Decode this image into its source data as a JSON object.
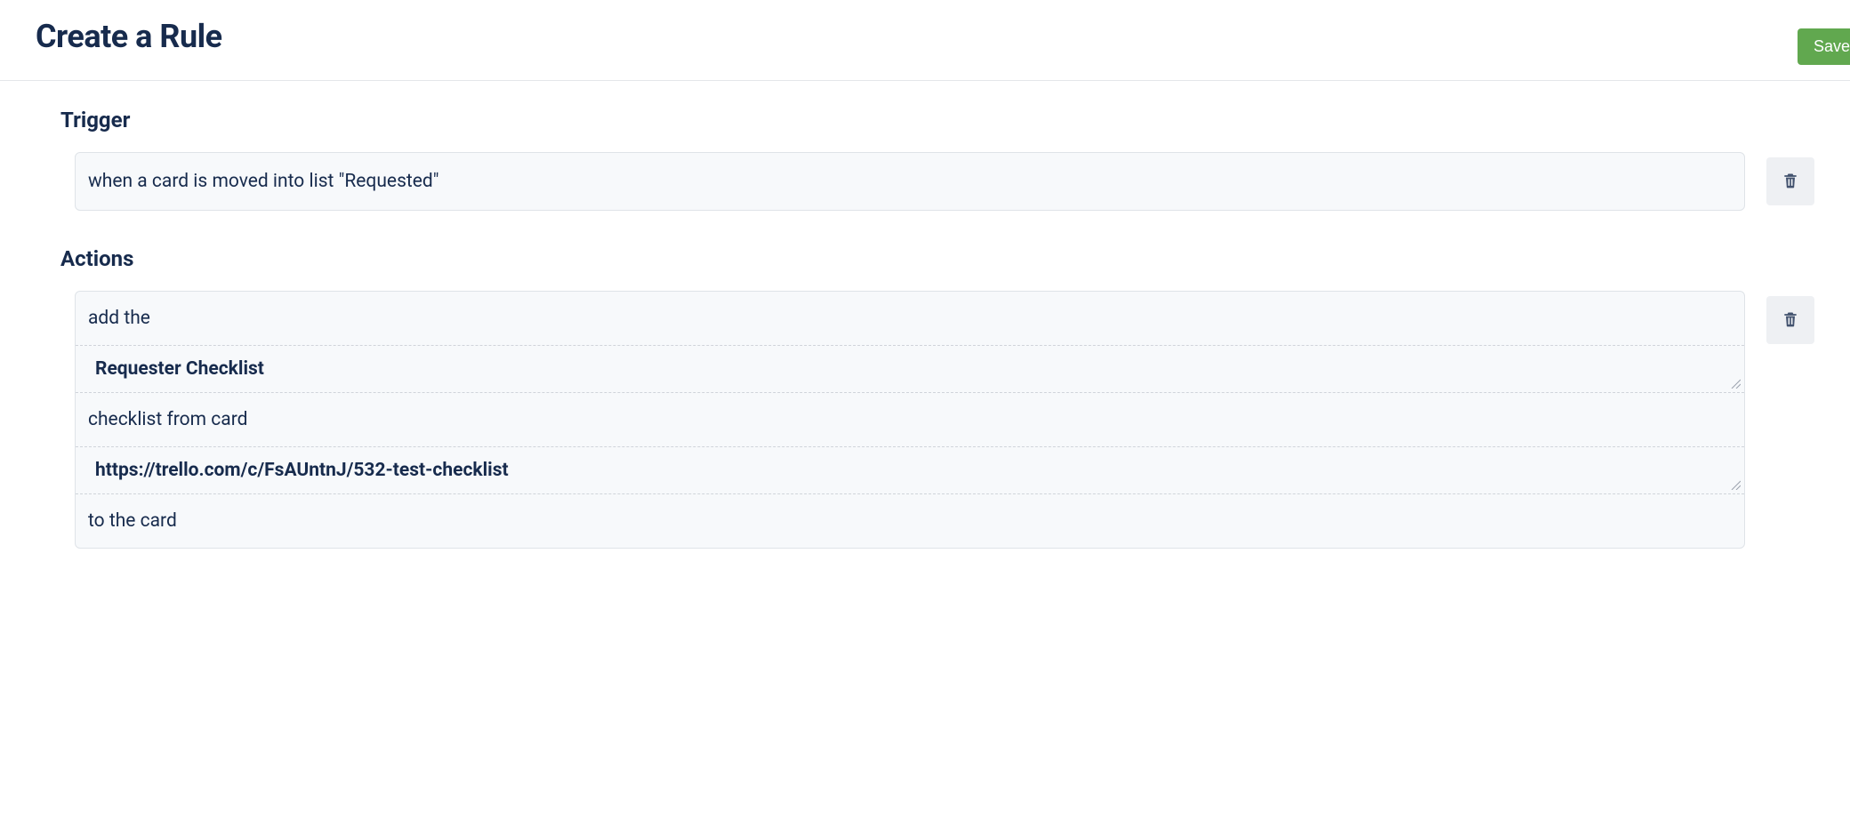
{
  "header": {
    "title": "Create a Rule",
    "save_label": "Save"
  },
  "trigger": {
    "heading": "Trigger",
    "text": "when a card is moved into list \"Requested\""
  },
  "actions": {
    "heading": "Actions",
    "segments": {
      "part1": "add the",
      "checklist_name": "Requester Checklist",
      "part2": "checklist from card",
      "card_url": "https://trello.com/c/FsAUntnJ/532-test-checklist",
      "part3": "to the card"
    }
  }
}
